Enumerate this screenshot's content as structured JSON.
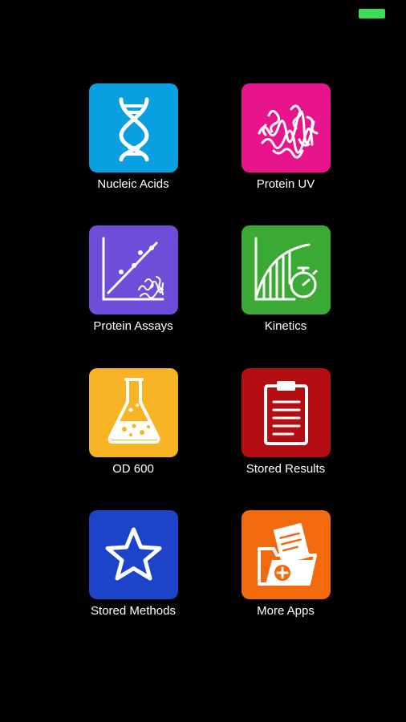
{
  "status_bar": {
    "battery_color": "#3cdc5a"
  },
  "apps": [
    {
      "label": "Nucleic Acids",
      "icon": "dna-icon",
      "color": "#0aa0e0"
    },
    {
      "label": "Protein UV",
      "icon": "protein-icon",
      "color": "#e8148c"
    },
    {
      "label": "Protein Assays",
      "icon": "standard-curve-icon",
      "color": "#6e4ed8"
    },
    {
      "label": "Kinetics",
      "icon": "kinetics-stopwatch-icon",
      "color": "#3aaa35"
    },
    {
      "label": "OD 600",
      "icon": "flask-icon",
      "color": "#f7b526"
    },
    {
      "label": "Stored Results",
      "icon": "clipboard-icon",
      "color": "#b50e12"
    },
    {
      "label": "Stored Methods",
      "icon": "star-icon",
      "color": "#1b44c8"
    },
    {
      "label": "More Apps",
      "icon": "folder-plus-icon",
      "color": "#f26a0e"
    }
  ]
}
